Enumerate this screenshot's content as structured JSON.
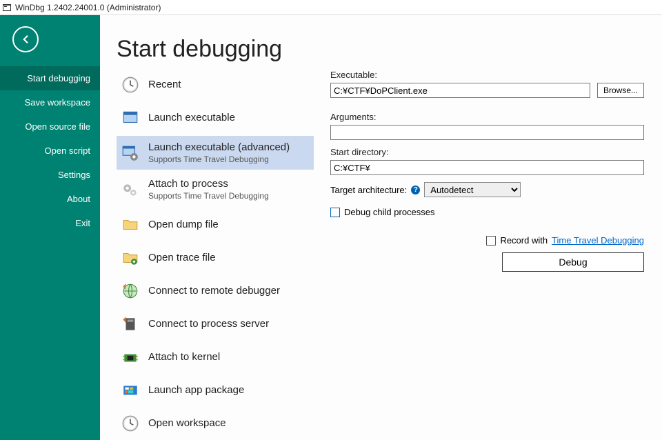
{
  "titlebar": {
    "text": "WinDbg 1.2402.24001.0 (Administrator)"
  },
  "sidebar": {
    "items": [
      {
        "label": "Start debugging",
        "selected": true
      },
      {
        "label": "Save workspace"
      },
      {
        "label": "Open source file"
      },
      {
        "label": "Open script"
      },
      {
        "label": "Settings"
      },
      {
        "label": "About"
      },
      {
        "label": "Exit"
      }
    ]
  },
  "page": {
    "title": "Start debugging",
    "list": [
      {
        "label": "Recent",
        "sub": "",
        "icon": "clock",
        "selected": false
      },
      {
        "label": "Launch executable",
        "sub": "",
        "icon": "window",
        "selected": false
      },
      {
        "label": "Launch executable (advanced)",
        "sub": "Supports Time Travel Debugging",
        "icon": "window-gear",
        "selected": true
      },
      {
        "label": "Attach to process",
        "sub": "Supports Time Travel Debugging",
        "icon": "gears",
        "selected": false
      },
      {
        "label": "Open dump file",
        "sub": "",
        "icon": "folder",
        "selected": false
      },
      {
        "label": "Open trace file",
        "sub": "",
        "icon": "folder-arrow",
        "selected": false
      },
      {
        "label": "Connect to remote debugger",
        "sub": "",
        "icon": "globe-arrow",
        "selected": false
      },
      {
        "label": "Connect to process server",
        "sub": "",
        "icon": "server-arrow",
        "selected": false
      },
      {
        "label": "Attach to kernel",
        "sub": "",
        "icon": "chip",
        "selected": false
      },
      {
        "label": "Launch app package",
        "sub": "",
        "icon": "apps",
        "selected": false
      },
      {
        "label": "Open workspace",
        "sub": "",
        "icon": "clock",
        "selected": false
      }
    ],
    "form": {
      "exe_label": "Executable:",
      "exe_value": "C:¥CTF¥DoPClient.exe",
      "browse_label": "Browse...",
      "args_label": "Arguments:",
      "args_value": "",
      "startdir_label": "Start directory:",
      "startdir_value": "C:¥CTF¥",
      "arch_label": "Target architecture:",
      "arch_value": "Autodetect",
      "debug_child_label": "Debug child processes",
      "record_label": "Record with ",
      "ttd_link": "Time Travel Debugging",
      "debug_button": "Debug"
    }
  }
}
